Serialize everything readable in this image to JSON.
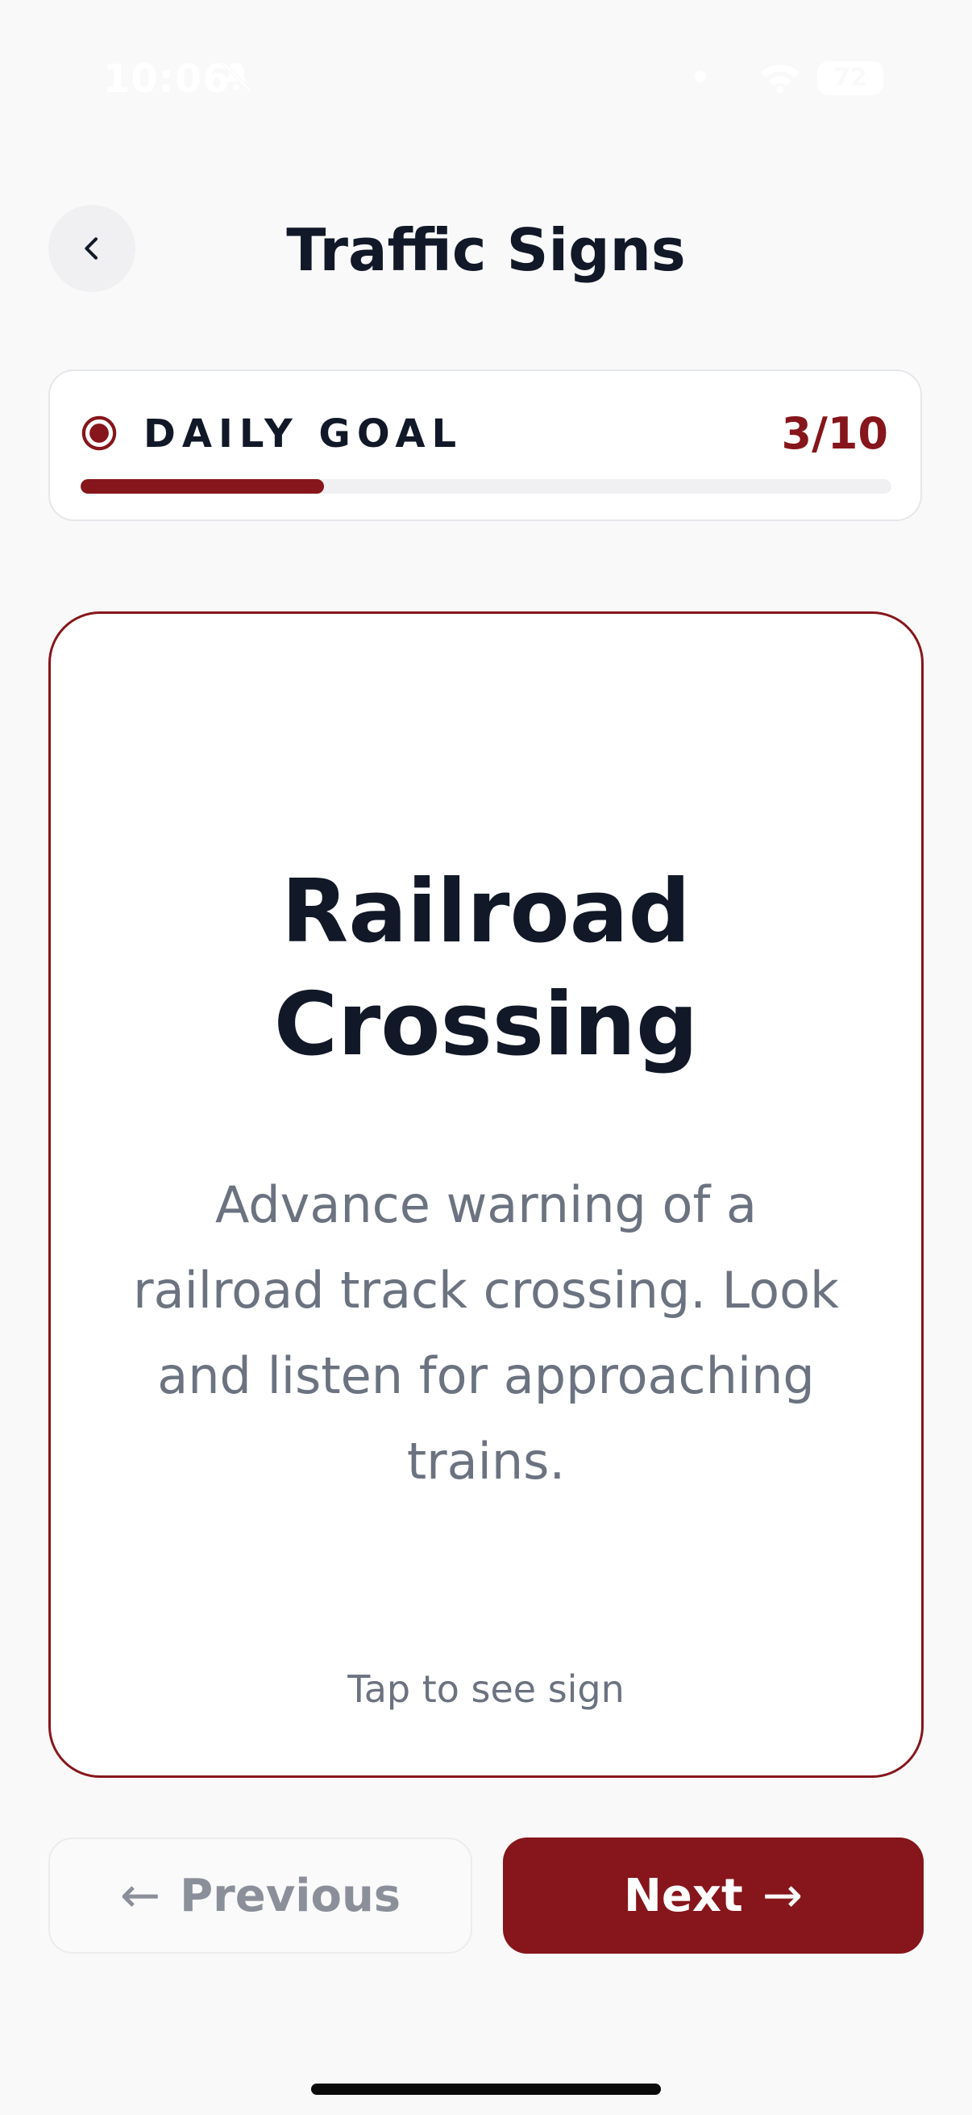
{
  "status_bar": {
    "time": "10:06",
    "battery": "72"
  },
  "header": {
    "title": "Traffic Signs"
  },
  "daily_goal": {
    "label": "DAILY GOAL",
    "count": "3/10",
    "progress_fraction": 0.3
  },
  "card": {
    "term": "Railroad Crossing",
    "definition": "Advance warning of a railroad track crossing. Look and listen for approaching trains.",
    "hint": "Tap to see sign"
  },
  "nav": {
    "previous_label": "Previous",
    "next_label": "Next"
  },
  "colors": {
    "accent": "#86161b",
    "title_text": "#111827",
    "muted_text": "#6b7280",
    "background": "#f9f9f9"
  },
  "icons": {
    "back": "chevron-left-icon",
    "goal": "target-icon",
    "previous": "arrow-left-icon",
    "next": "arrow-right-icon"
  }
}
